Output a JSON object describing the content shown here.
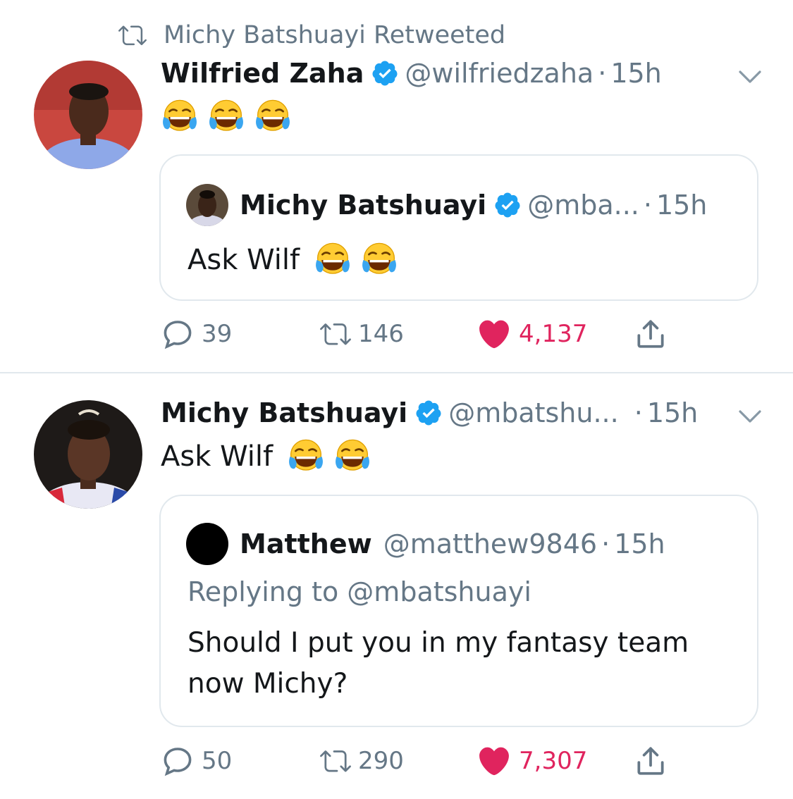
{
  "retweet_header": {
    "text": "Michy Batshuayi Retweeted"
  },
  "tweet1": {
    "author_name": "Wilfried Zaha",
    "handle": "@wilfriedzaha",
    "dot": "·",
    "time": "15h",
    "body_emojis": [
      "face-with-tears-of-joy",
      "face-with-tears-of-joy",
      "face-with-tears-of-joy"
    ],
    "quote": {
      "author_name": "Michy Batshuayi",
      "handle": "@mba...",
      "dot": "·",
      "time": "15h",
      "text": "Ask Wilf",
      "emojis": [
        "face-with-tears-of-joy",
        "face-with-tears-of-joy"
      ]
    },
    "actions": {
      "replies": "39",
      "retweets": "146",
      "likes": "4,137"
    }
  },
  "tweet2": {
    "author_name": "Michy Batshuayi",
    "handle": "@mbatshu...",
    "dot": "·",
    "time": "15h",
    "text": "Ask Wilf",
    "emojis": [
      "face-with-tears-of-joy",
      "face-with-tears-of-joy"
    ],
    "quote": {
      "author_name": "Matthew",
      "handle": "@matthew9846",
      "dot": "·",
      "time": "15h",
      "replying_to": "Replying to @mbatshuayi",
      "text_line1": "Should I put you in my fantasy team",
      "text_line2": "now Michy?"
    },
    "actions": {
      "replies": "50",
      "retweets": "290",
      "likes": "7,307"
    }
  },
  "colors": {
    "verified_blue": "#1da1f2",
    "like_red": "#e0245e",
    "gray_text": "#657786",
    "border": "#e1e8ed"
  }
}
